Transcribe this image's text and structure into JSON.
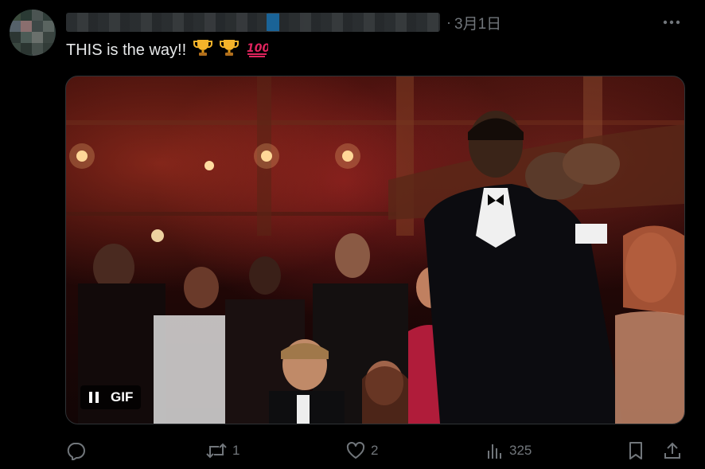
{
  "tweet": {
    "date": "3月1日",
    "dot": "·",
    "text": "THIS is the way!!",
    "emojis": [
      "trophy-icon",
      "trophy-icon",
      "hundred-points-icon"
    ]
  },
  "media": {
    "badge_label": "GIF",
    "pause_icon": "pause-icon"
  },
  "actions": {
    "reply_count": "",
    "retweet_count": "1",
    "like_count": "2",
    "views_count": "325"
  },
  "colors": {
    "background": "#000000",
    "text": "#e7e9ea",
    "muted": "#71767b",
    "border": "#2f3336"
  }
}
